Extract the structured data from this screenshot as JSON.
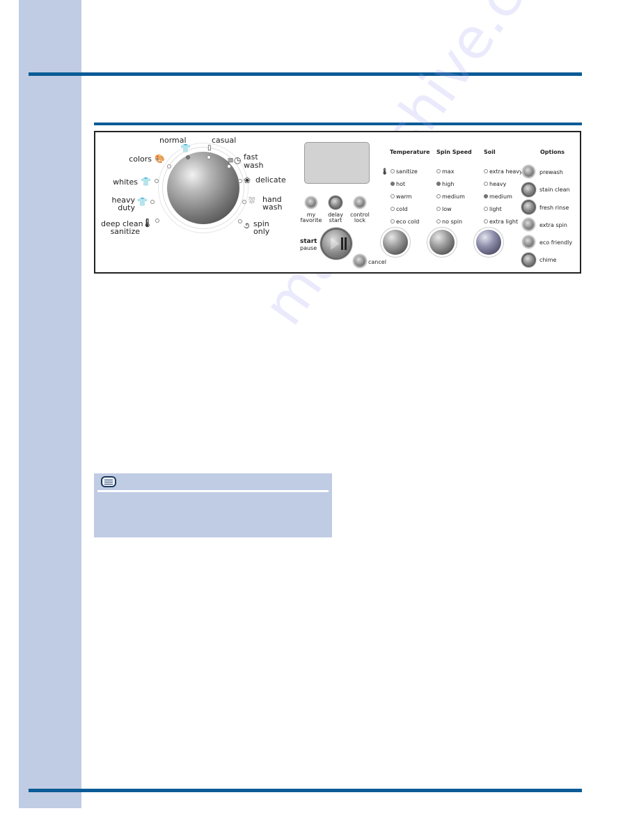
{
  "page": {
    "accent_color": "#0a5b96",
    "sidebar_color": "#c0cce3",
    "watermark": "manualshive.com"
  },
  "control_panel": {
    "cycle_selector": {
      "cycles": [
        {
          "label": "normal",
          "icon": "tshirt-icon",
          "selected": true
        },
        {
          "label": "casual",
          "icon": "shirt-collar-icon",
          "selected": false
        },
        {
          "label": "fast wash",
          "line1": "fast",
          "line2": "wash",
          "icon": "clock-speed-icon",
          "selected": false
        },
        {
          "label": "delicate",
          "icon": "flower-icon",
          "selected": false
        },
        {
          "label": "hand wash",
          "line1": "hand",
          "line2": "wash",
          "icon": "hand-wash-icon",
          "selected": false
        },
        {
          "label": "spin only",
          "line1": "spin",
          "line2": "only",
          "icon": "spiral-icon",
          "selected": false
        },
        {
          "label": "deep clean sanitize",
          "line1": "deep clean",
          "line2": "sanitize",
          "icon": "thermometer-plus-icon",
          "selected": false
        },
        {
          "label": "heavy duty",
          "line1": "heavy",
          "line2": "duty",
          "icon": "heavy-shirt-icon",
          "selected": false
        },
        {
          "label": "whites",
          "icon": "sparkle-shirt-icon",
          "selected": false
        },
        {
          "label": "colors",
          "icon": "palette-icon",
          "selected": false
        }
      ]
    },
    "function_buttons": [
      {
        "line1": "my",
        "line2": "favorite"
      },
      {
        "line1": "delay",
        "line2": "start"
      },
      {
        "line1": "control",
        "line2": "lock"
      }
    ],
    "start": {
      "label": "start",
      "sublabel": "pause"
    },
    "cancel": {
      "label": "cancel"
    },
    "temperature": {
      "title": "Temperature",
      "options": [
        {
          "label": "sanitize",
          "selected": false
        },
        {
          "label": "hot",
          "selected": true
        },
        {
          "label": "warm",
          "selected": false
        },
        {
          "label": "cold",
          "selected": false
        },
        {
          "label": "eco cold",
          "selected": false
        }
      ]
    },
    "spin_speed": {
      "title": "Spin Speed",
      "options": [
        {
          "label": "max",
          "selected": false
        },
        {
          "label": "high",
          "selected": true
        },
        {
          "label": "medium",
          "selected": false
        },
        {
          "label": "low",
          "selected": false
        },
        {
          "label": "no spin",
          "selected": false
        }
      ]
    },
    "soil": {
      "title": "Soil",
      "options": [
        {
          "label": "extra heavy",
          "selected": false
        },
        {
          "label": "heavy",
          "selected": false
        },
        {
          "label": "medium",
          "selected": true
        },
        {
          "label": "light",
          "selected": false
        },
        {
          "label": "extra light",
          "selected": false
        }
      ]
    },
    "options": {
      "title": "Options",
      "items": [
        {
          "label": "prewash"
        },
        {
          "label": "stain clean"
        },
        {
          "label": "fresh rinse"
        },
        {
          "label": "extra spin"
        },
        {
          "label": "eco friendly"
        },
        {
          "label": "chime"
        }
      ]
    }
  },
  "note": {
    "icon": "speech-bubble-note-icon",
    "text": ""
  }
}
